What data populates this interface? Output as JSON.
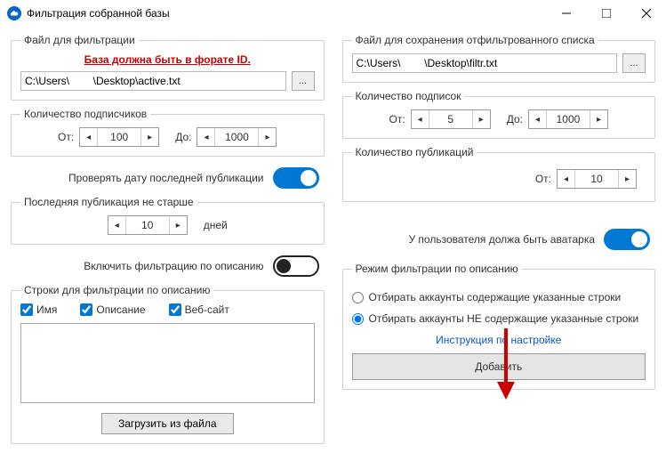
{
  "window": {
    "title": "Фильтрация собранной базы"
  },
  "left": {
    "fileGroup": {
      "legend": "Файл для фильтрации",
      "warn": "База должна быть в форате ID.",
      "path": "C:\\Users\\        \\Desktop\\active.txt",
      "dots": "..."
    },
    "subsGroup": {
      "legend": "Количество подписчиков",
      "from": "От:",
      "fromVal": "100",
      "to": "До:",
      "toVal": "1000"
    },
    "checkDateToggle": "Проверять дату последней публикации",
    "lastPub": {
      "legend": "Последняя публикация не старше",
      "val": "10",
      "unit": "дней"
    },
    "descToggle": "Включить фильтрацию по описанию",
    "descGroup": {
      "legend": "Строки для фильтрации по описанию",
      "chk1": "Имя",
      "chk2": "Описание",
      "chk3": "Веб-сайт",
      "loadBtn": "Загрузить из файла"
    }
  },
  "right": {
    "saveGroup": {
      "legend": "Файл для сохранения отфильтрованного списка",
      "path": "C:\\Users\\        \\Desktop\\filtr.txt",
      "dots": "..."
    },
    "followsGroup": {
      "legend": "Количество подписок",
      "from": "От:",
      "fromVal": "5",
      "to": "До:",
      "toVal": "1000"
    },
    "pubsGroup": {
      "legend": "Количество публикаций",
      "from": "От:",
      "val": "10"
    },
    "avatarToggle": "У пользователя должа быть аватарка",
    "modeGroup": {
      "legend": "Режим фильтрации по описанию",
      "opt1": "Отбирать аккаунты содержащие указанные строки",
      "opt2": "Отбирать аккаунты НЕ содержащие указанные строки",
      "instr": "Инструкция по настройке",
      "addBtn": "Добавить"
    }
  }
}
